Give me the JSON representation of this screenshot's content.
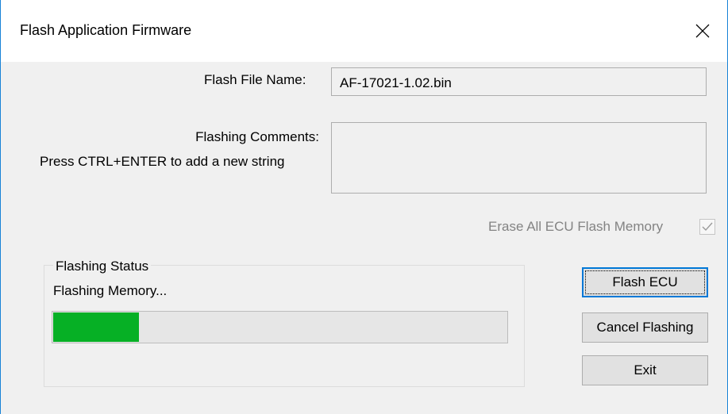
{
  "window": {
    "title": "Flash Application Firmware",
    "close_icon": "close-icon"
  },
  "form": {
    "flash_file_label": "Flash File Name:",
    "flash_file_value": "AF-17021-1.02.bin",
    "comments_label": "Flashing Comments:",
    "comments_hint": "Press CTRL+ENTER to add a new string",
    "comments_value": "",
    "erase_label": "Erase All ECU Flash Memory",
    "erase_checked": true,
    "erase_enabled": false
  },
  "status": {
    "group_title": "Flashing Status",
    "message": "Flashing Memory...",
    "progress_fraction": 0.19,
    "progress_color": "#06b025"
  },
  "buttons": {
    "flash_label": "Flash ECU",
    "cancel_label": "Cancel Flashing",
    "exit_label": "Exit"
  },
  "colors": {
    "window_border": "#1883d7",
    "default_button_border": "#0078d7"
  }
}
